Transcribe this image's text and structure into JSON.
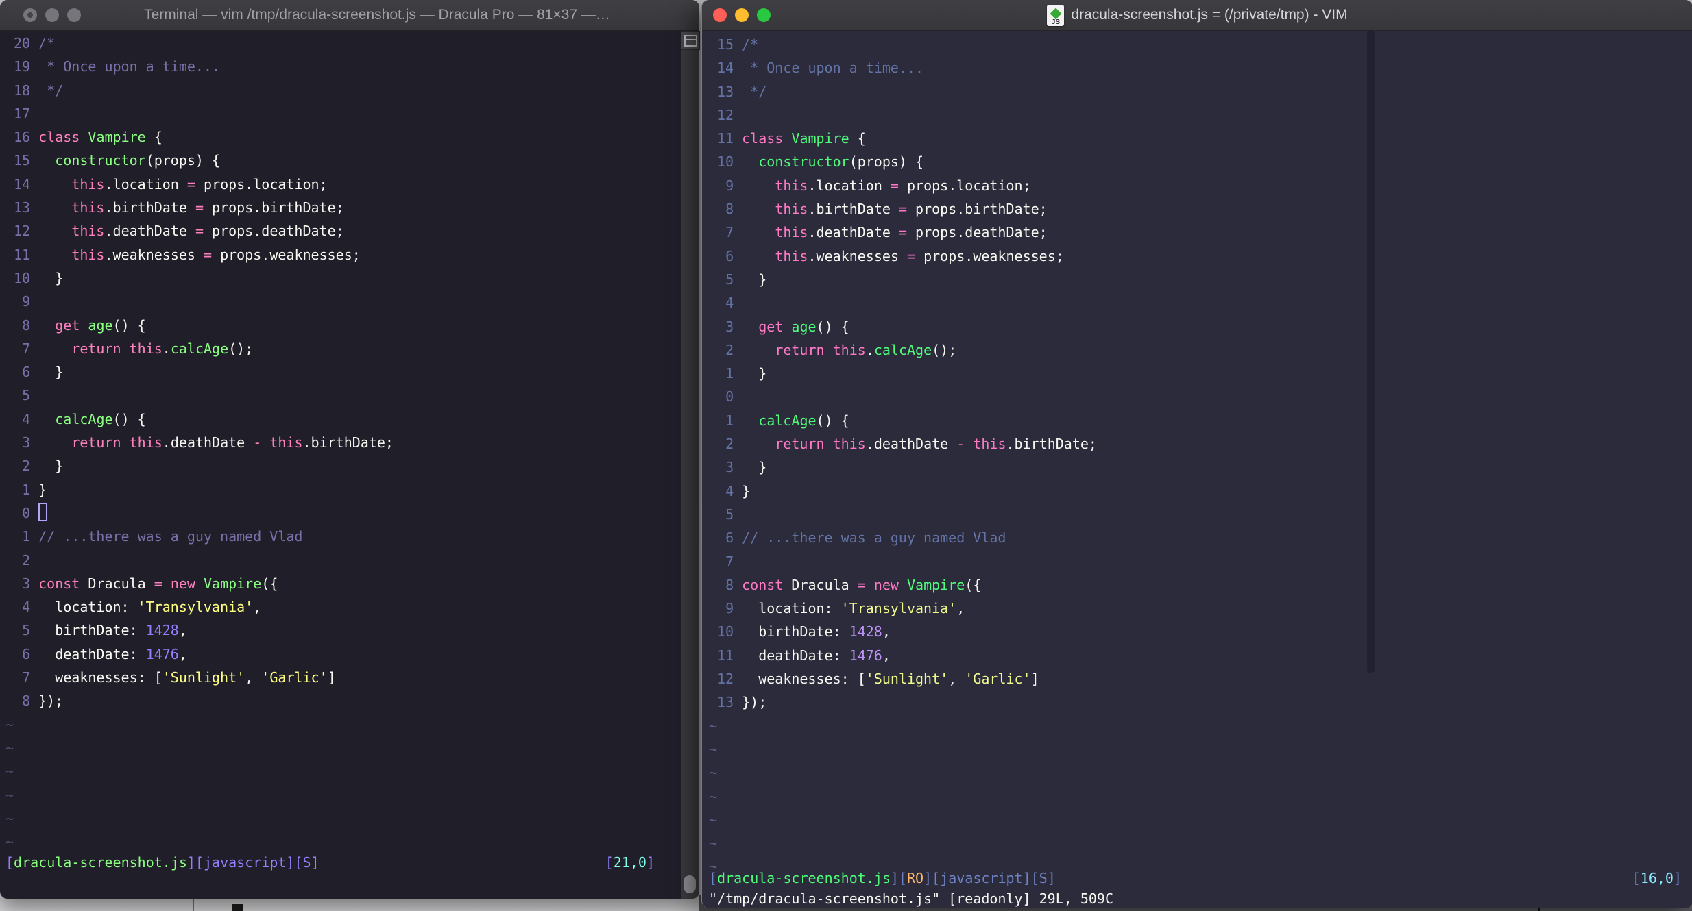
{
  "code_lines": [
    {
      "segs": [
        [
          "comment",
          "/*"
        ]
      ]
    },
    {
      "segs": [
        [
          "comment",
          " * Once upon a time..."
        ]
      ]
    },
    {
      "segs": [
        [
          "comment",
          " */"
        ]
      ]
    },
    {
      "segs": []
    },
    {
      "segs": [
        [
          "pink",
          "class"
        ],
        [
          "green",
          " Vampire"
        ],
        [
          "fg",
          " {"
        ]
      ]
    },
    {
      "segs": [
        [
          "fg",
          "  "
        ],
        [
          "green",
          "constructor"
        ],
        [
          "fg",
          "(props) {"
        ]
      ]
    },
    {
      "segs": [
        [
          "fg",
          "    "
        ],
        [
          "pink",
          "this"
        ],
        [
          "fg",
          ".location "
        ],
        [
          "pink",
          "="
        ],
        [
          "fg",
          " props.location;"
        ]
      ]
    },
    {
      "segs": [
        [
          "fg",
          "    "
        ],
        [
          "pink",
          "this"
        ],
        [
          "fg",
          ".birthDate "
        ],
        [
          "pink",
          "="
        ],
        [
          "fg",
          " props.birthDate;"
        ]
      ]
    },
    {
      "segs": [
        [
          "fg",
          "    "
        ],
        [
          "pink",
          "this"
        ],
        [
          "fg",
          ".deathDate "
        ],
        [
          "pink",
          "="
        ],
        [
          "fg",
          " props.deathDate;"
        ]
      ]
    },
    {
      "segs": [
        [
          "fg",
          "    "
        ],
        [
          "pink",
          "this"
        ],
        [
          "fg",
          ".weaknesses "
        ],
        [
          "pink",
          "="
        ],
        [
          "fg",
          " props.weaknesses;"
        ]
      ]
    },
    {
      "segs": [
        [
          "fg",
          "  }"
        ]
      ]
    },
    {
      "segs": []
    },
    {
      "segs": [
        [
          "fg",
          "  "
        ],
        [
          "pink",
          "get"
        ],
        [
          "green",
          " age"
        ],
        [
          "fg",
          "() {"
        ]
      ]
    },
    {
      "segs": [
        [
          "fg",
          "    "
        ],
        [
          "pink",
          "return"
        ],
        [
          "fg",
          " "
        ],
        [
          "pink",
          "this"
        ],
        [
          "fg",
          "."
        ],
        [
          "green",
          "calcAge"
        ],
        [
          "fg",
          "();"
        ]
      ]
    },
    {
      "segs": [
        [
          "fg",
          "  }"
        ]
      ]
    },
    {
      "segs": []
    },
    {
      "segs": [
        [
          "fg",
          "  "
        ],
        [
          "green",
          "calcAge"
        ],
        [
          "fg",
          "() {"
        ]
      ]
    },
    {
      "segs": [
        [
          "fg",
          "    "
        ],
        [
          "pink",
          "return"
        ],
        [
          "fg",
          " "
        ],
        [
          "pink",
          "this"
        ],
        [
          "fg",
          ".deathDate "
        ],
        [
          "pink",
          "-"
        ],
        [
          "fg",
          " "
        ],
        [
          "pink",
          "this"
        ],
        [
          "fg",
          ".birthDate;"
        ]
      ]
    },
    {
      "segs": [
        [
          "fg",
          "  }"
        ]
      ]
    },
    {
      "segs": [
        [
          "fg",
          "}"
        ]
      ]
    },
    {
      "segs": []
    },
    {
      "segs": [
        [
          "comment",
          "// ...there was a guy named Vlad"
        ]
      ]
    },
    {
      "segs": []
    },
    {
      "segs": [
        [
          "pink",
          "const"
        ],
        [
          "fg",
          " Dracula "
        ],
        [
          "pink",
          "="
        ],
        [
          "fg",
          " "
        ],
        [
          "pink",
          "new"
        ],
        [
          "green",
          " Vampire"
        ],
        [
          "fg",
          "({"
        ]
      ]
    },
    {
      "segs": [
        [
          "fg",
          "  location: "
        ],
        [
          "yellow",
          "'Transylvania'"
        ],
        [
          "fg",
          ","
        ]
      ]
    },
    {
      "segs": [
        [
          "fg",
          "  birthDate: "
        ],
        [
          "purple",
          "1428"
        ],
        [
          "fg",
          ","
        ]
      ]
    },
    {
      "segs": [
        [
          "fg",
          "  deathDate: "
        ],
        [
          "purple",
          "1476"
        ],
        [
          "fg",
          ","
        ]
      ]
    },
    {
      "segs": [
        [
          "fg",
          "  weaknesses: ["
        ],
        [
          "yellow",
          "'Sunlight'"
        ],
        [
          "fg",
          ", "
        ],
        [
          "yellow",
          "'Garlic'"
        ],
        [
          "fg",
          "]"
        ]
      ]
    },
    {
      "segs": [
        [
          "fg",
          "});"
        ]
      ]
    }
  ],
  "tilde": "~",
  "left_window": {
    "title": "Terminal — vim /tmp/dracula-screenshot.js — Dracula Pro — 81×37 —…",
    "theme_name": "Dracula Pro",
    "relnums": [
      "20",
      "19",
      "18",
      "17",
      "16",
      "15",
      "14",
      "13",
      "12",
      "11",
      "10",
      "9",
      "8",
      "7",
      "6",
      "5",
      "4",
      "3",
      "2",
      "1",
      "0",
      "1",
      "2",
      "3",
      "4",
      "5",
      "6",
      "7",
      "8"
    ],
    "tilde_rows": 6,
    "cursor_row": 21,
    "palette": {
      "fg": "#f8f8f2",
      "comment": "#7970a9",
      "pink": "#ff80bf",
      "green": "#8aff80",
      "yellow": "#ffff80",
      "purple": "#9580ff",
      "cyan": "#80ffea",
      "linenr": "#7970a9",
      "tilde": "#4f4a6b",
      "background": "#201f29"
    },
    "status_segments": [
      {
        "t": "[",
        "c": "purple"
      },
      {
        "t": "dracula-screenshot.js",
        "c": "green"
      },
      {
        "t": "][javascript][S]",
        "c": "purple"
      }
    ],
    "ruler_segments": [
      {
        "t": "[",
        "c": "purple"
      },
      {
        "t": "21,0",
        "c": "cyan"
      },
      {
        "t": "]",
        "c": "purple"
      }
    ]
  },
  "right_window": {
    "title": "dracula-screenshot.js = (/private/tmp) - VIM",
    "doc_icon_label": "JS",
    "relnums": [
      "15",
      "14",
      "13",
      "12",
      "11",
      "10",
      "9",
      "8",
      "7",
      "6",
      "5",
      "4",
      "3",
      "2",
      "1",
      "0",
      "1",
      "2",
      "3",
      "4",
      "5",
      "6",
      "7",
      "8",
      "9",
      "10",
      "11",
      "12",
      "13"
    ],
    "tilde_rows": 7,
    "cursor_row": null,
    "palette": {
      "fg": "#f8f8f2",
      "comment": "#6473a6",
      "pink": "#ff79c6",
      "green": "#50fa7b",
      "yellow": "#f1fa8c",
      "purple": "#bd93f9",
      "cyan": "#8be9fd",
      "orange": "#ffb86c",
      "blue": "#6f83c6",
      "linenr": "#6473a6",
      "tilde": "#5a6288",
      "background": "#2b2b3b"
    },
    "status_segments": [
      {
        "t": "[",
        "c": "blue"
      },
      {
        "t": "dracula-screenshot.js",
        "c": "green"
      },
      {
        "t": "][",
        "c": "blue"
      },
      {
        "t": "RO",
        "c": "orange"
      },
      {
        "t": "][javascript][S]",
        "c": "blue"
      }
    ],
    "ruler_segments": [
      {
        "t": "[",
        "c": "blue"
      },
      {
        "t": "16,0",
        "c": "cyan"
      },
      {
        "t": "]",
        "c": "blue"
      }
    ],
    "cmdline": "\"/tmp/dracula-screenshot.js\" [readonly] 29L, 509C"
  }
}
